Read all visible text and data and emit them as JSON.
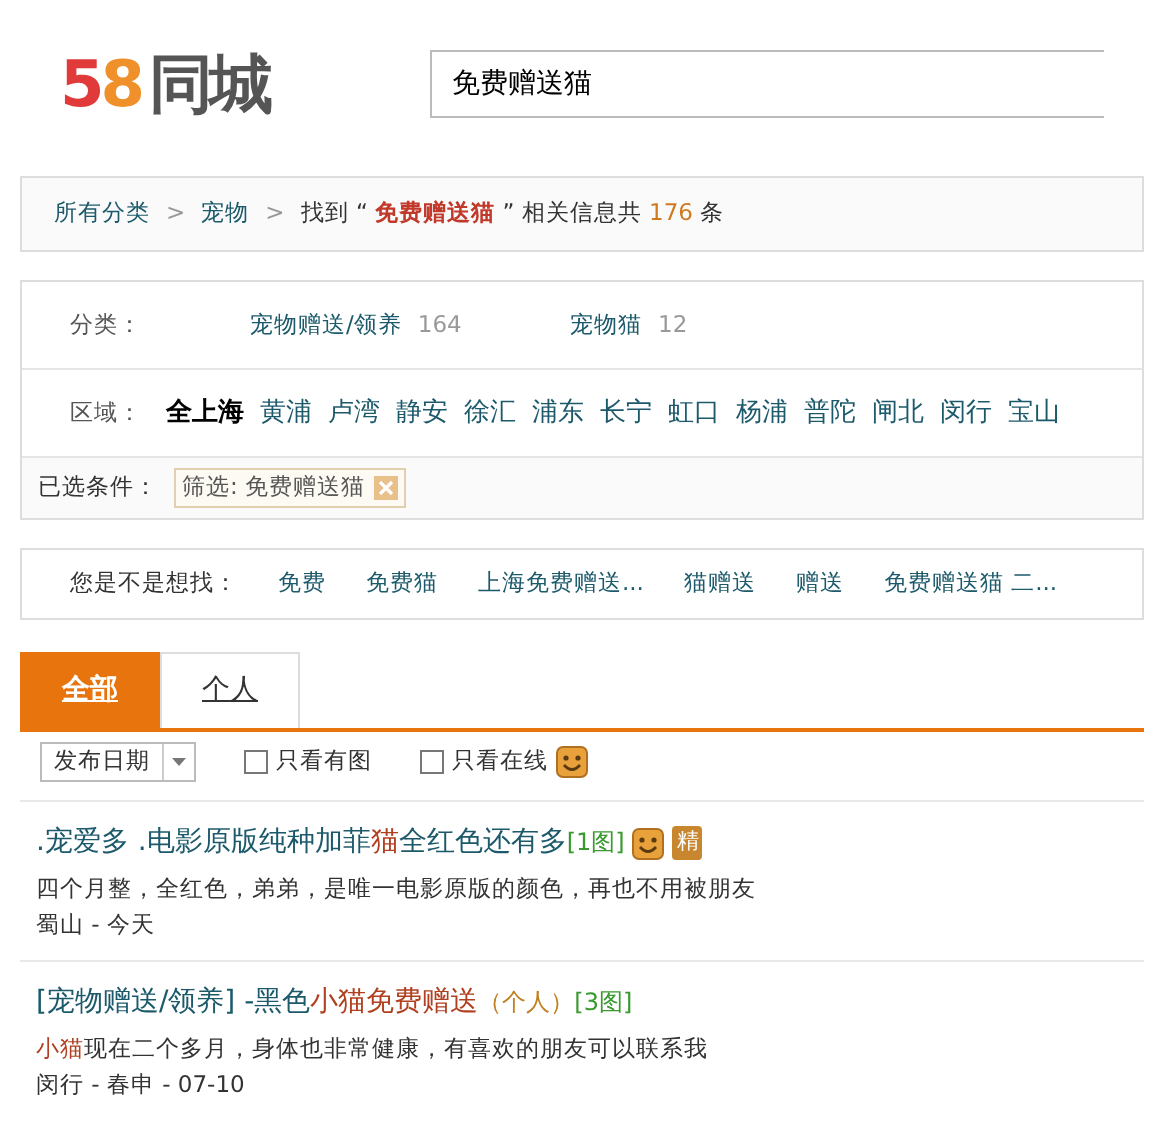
{
  "logo": {
    "digits": "58",
    "name": "同城"
  },
  "search": {
    "value": "免费赠送猫"
  },
  "breadcrumb": {
    "items": [
      "所有分类",
      "宠物"
    ],
    "separator": ">",
    "found": "找到",
    "open_quote": "“",
    "keyword": "免费赠送猫",
    "close_quote": "”",
    "summary": "相关信息共",
    "count": "176",
    "unit": "条"
  },
  "categories": {
    "label": "分类：",
    "items": [
      {
        "name": "宠物赠送/领养",
        "count": "164"
      },
      {
        "name": "宠物猫",
        "count": "12"
      }
    ]
  },
  "areas": {
    "label": "区域：",
    "items": [
      {
        "name": "全上海",
        "selected": true
      },
      {
        "name": "黄浦",
        "selected": false
      },
      {
        "name": "卢湾",
        "selected": false
      },
      {
        "name": "静安",
        "selected": false
      },
      {
        "name": "徐汇",
        "selected": false
      },
      {
        "name": "浦东",
        "selected": false
      },
      {
        "name": "长宁",
        "selected": false
      },
      {
        "name": "虹口",
        "selected": false
      },
      {
        "name": "杨浦",
        "selected": false
      },
      {
        "name": "普陀",
        "selected": false
      },
      {
        "name": "闸北",
        "selected": false
      },
      {
        "name": "闵行",
        "selected": false
      },
      {
        "name": "宝山",
        "selected": false
      }
    ]
  },
  "selected_filters": {
    "label": "已选条件：",
    "chips": [
      "筛选: 免费赠送猫"
    ]
  },
  "suggestions": {
    "label": "您是不是想找：",
    "items": [
      "免费",
      "免费猫",
      "上海免费赠送...",
      "猫赠送",
      "赠送",
      "免费赠送猫 二..."
    ]
  },
  "tabs": [
    {
      "label": "全部",
      "selected": true
    },
    {
      "label": "个人",
      "selected": false
    }
  ],
  "filters": {
    "sort": "发布日期",
    "checkboxes": [
      {
        "label": "只看有图",
        "checked": false,
        "smiley": false
      },
      {
        "label": "只看在线",
        "checked": false,
        "smiley": true
      }
    ]
  },
  "listings": [
    {
      "title": [
        {
          "kind": "text",
          "text": ".宠爱多 .电影原版纯种加菲"
        },
        {
          "kind": "hit",
          "text": "猫"
        },
        {
          "kind": "text",
          "text": "全红色还有多"
        },
        {
          "kind": "photos",
          "text": "[1图]"
        }
      ],
      "smiley": true,
      "badge": "精",
      "description": [
        {
          "kind": "plain",
          "text": "四个月整，全红色，弟弟，是唯一电影原版的颜色，再也不用被朋友"
        }
      ],
      "meta": "蜀山 - 今天"
    },
    {
      "title": [
        {
          "kind": "text",
          "text": "[宠物赠送/领养] -黑色"
        },
        {
          "kind": "hit",
          "text": "小猫免费赠送"
        },
        {
          "kind": "owner",
          "text": "（个人）"
        },
        {
          "kind": "photos",
          "text": "[3图]"
        }
      ],
      "smiley": false,
      "description": [
        {
          "kind": "hit",
          "text": "小猫"
        },
        {
          "kind": "plain",
          "text": "现在二个多月，身体也非常健康，有喜欢的朋友可以联系我"
        }
      ],
      "meta": "闵行 - 春申 - 07-10"
    }
  ]
}
